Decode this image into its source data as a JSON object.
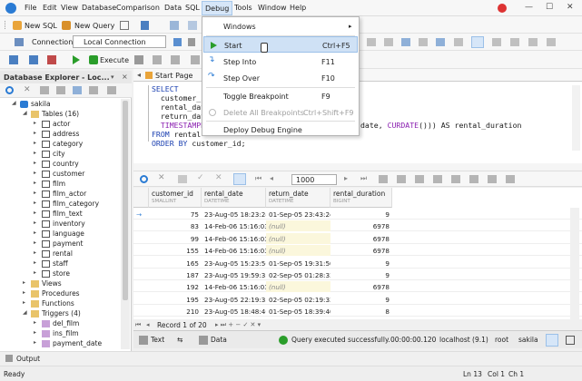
{
  "menubar": {
    "items": [
      "File",
      "Edit",
      "View",
      "Database",
      "Comparison",
      "Data",
      "SQL",
      "Debug",
      "Tools",
      "Window",
      "Help"
    ]
  },
  "toolbar1": {
    "new_sql": "New SQL",
    "new_query": "New Query"
  },
  "toolbar2": {
    "connection_label": "Connection",
    "connection_value": "Local Connection"
  },
  "toolbar3": {
    "execute": "Execute"
  },
  "debug_menu": {
    "windows": "Windows",
    "start": "Start",
    "start_key": "Ctrl+F5",
    "step_into": "Step Into",
    "step_into_key": "F11",
    "step_over": "Step Over",
    "step_over_key": "F10",
    "toggle_bp": "Toggle Breakpoint",
    "toggle_bp_key": "F9",
    "delete_bp": "Delete All Breakpoints",
    "delete_bp_key": "Ctrl+Shift+F9",
    "deploy": "Deploy Debug Engine"
  },
  "explorer": {
    "title": "Database Explorer - Loc...",
    "nodes": [
      {
        "label": "sakila",
        "icon": "database"
      },
      {
        "label": "Tables (16)",
        "icon": "folder"
      },
      {
        "label": "actor",
        "icon": "table"
      },
      {
        "label": "address",
        "icon": "table"
      },
      {
        "label": "category",
        "icon": "table"
      },
      {
        "label": "city",
        "icon": "table"
      },
      {
        "label": "country",
        "icon": "table"
      },
      {
        "label": "customer",
        "icon": "table"
      },
      {
        "label": "film",
        "icon": "table"
      },
      {
        "label": "film_actor",
        "icon": "table"
      },
      {
        "label": "film_category",
        "icon": "table"
      },
      {
        "label": "film_text",
        "icon": "table"
      },
      {
        "label": "inventory",
        "icon": "table"
      },
      {
        "label": "language",
        "icon": "table"
      },
      {
        "label": "payment",
        "icon": "table"
      },
      {
        "label": "rental",
        "icon": "table"
      },
      {
        "label": "staff",
        "icon": "table"
      },
      {
        "label": "store",
        "icon": "table"
      },
      {
        "label": "Views",
        "icon": "folder"
      },
      {
        "label": "Procedures",
        "icon": "folder"
      },
      {
        "label": "Functions",
        "icon": "folder"
      },
      {
        "label": "Triggers (4)",
        "icon": "folder"
      },
      {
        "label": "del_film",
        "icon": "trigger"
      },
      {
        "label": "ins_film",
        "icon": "trigger"
      },
      {
        "label": "payment_date",
        "icon": "trigger"
      }
    ]
  },
  "editor": {
    "tab": "Start Page",
    "lines": {
      "l1": "SELECT",
      "l2": "  customer_i",
      "l3": "  rental_dat",
      "l4": "  return_dat",
      "l5": "  TIMESTAMPD",
      "l5b": "date, ",
      "l5c": "CURDATE",
      "l5d": "())) AS rental_duration",
      "l6a": "FROM",
      "l6b": " rental",
      "l7a": "ORDER BY",
      "l7b": " customer_id;"
    }
  },
  "gridtoolbar": {
    "limit": "1000"
  },
  "grid": {
    "columns": [
      {
        "name": "customer_id",
        "type": "SMALLINT"
      },
      {
        "name": "rental_date",
        "type": "DATETIME"
      },
      {
        "name": "return_date",
        "type": "DATETIME"
      },
      {
        "name": "rental_duration",
        "type": "BIGINT"
      }
    ],
    "rows": [
      [
        "75",
        "23-Aug-05 18:23:24",
        "01-Sep-05 23:43:24",
        "9"
      ],
      [
        "83",
        "14-Feb-06 15:16:03",
        "(null)",
        "6978"
      ],
      [
        "99",
        "14-Feb-06 15:16:03",
        "(null)",
        "6978"
      ],
      [
        "155",
        "14-Feb-06 15:16:03",
        "(null)",
        "6978"
      ],
      [
        "165",
        "23-Aug-05 15:23:50",
        "01-Sep-05 19:31:50",
        "9"
      ],
      [
        "187",
        "23-Aug-05 19:59:33",
        "02-Sep-05 01:28:33",
        "9"
      ],
      [
        "192",
        "14-Feb-06 15:16:03",
        "(null)",
        "6978"
      ],
      [
        "195",
        "23-Aug-05 22:19:33",
        "02-Sep-05 02:19:33",
        "9"
      ],
      [
        "210",
        "23-Aug-05 18:48:40",
        "01-Sep-05 18:39:40",
        "8"
      ]
    ]
  },
  "pager": {
    "text": "Record 1 of 20"
  },
  "bottom": {
    "text_tab": "Text",
    "data_tab": "Data",
    "status_msg": "Query executed successfully.",
    "time": "00:00:00.120",
    "server": "localhost (9.1)",
    "user": "root",
    "db": "sakila"
  },
  "output": {
    "label": "Output"
  },
  "statusbar": {
    "ready": "Ready",
    "ln": "Ln 13",
    "col": "Col 1",
    "ch": "Ch 1"
  },
  "colors": {
    "accent": "#2a7bd4",
    "highlight": "#cfe1f5",
    "keyword": "#1a3fb0",
    "function": "#8a1fb0",
    "null_bg": "#fbf7dc",
    "success": "#2a9d2a"
  }
}
